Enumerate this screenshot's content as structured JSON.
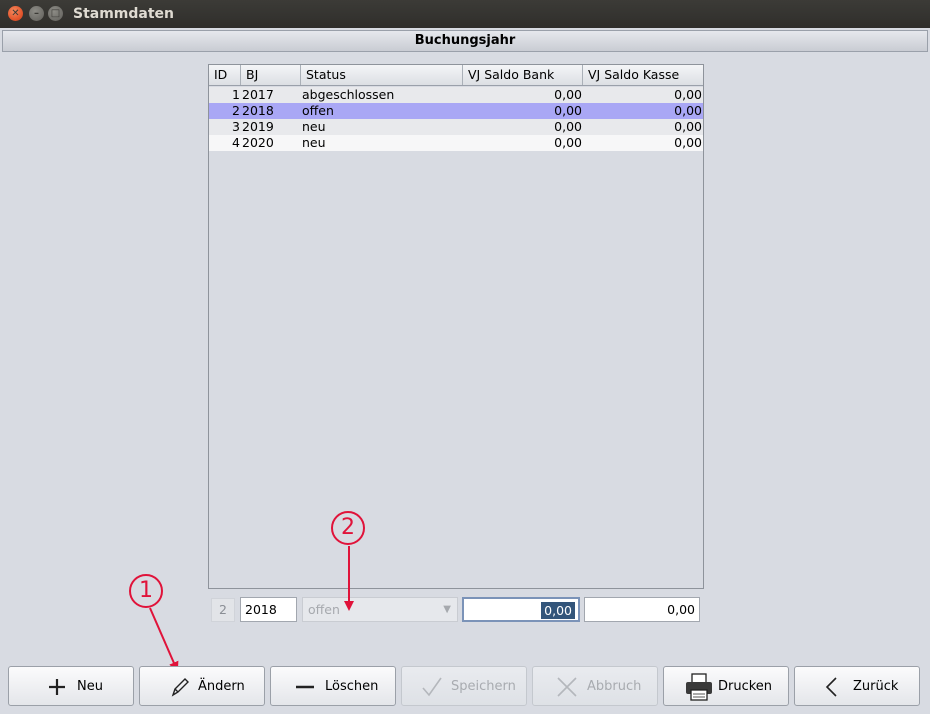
{
  "window": {
    "title": "Stammdaten"
  },
  "section": {
    "title": "Buchungsjahr"
  },
  "table": {
    "columns": [
      "ID",
      "BJ",
      "Status",
      "VJ Saldo Bank",
      "VJ Saldo Kasse"
    ],
    "rows": [
      {
        "id": "1",
        "bj": "2017",
        "status": "abgeschlossen",
        "bank": "0,00",
        "kasse": "0,00"
      },
      {
        "id": "2",
        "bj": "2018",
        "status": "offen",
        "bank": "0,00",
        "kasse": "0,00"
      },
      {
        "id": "3",
        "bj": "2019",
        "status": "neu",
        "bank": "0,00",
        "kasse": "0,00"
      },
      {
        "id": "4",
        "bj": "2020",
        "status": "neu",
        "bank": "0,00",
        "kasse": "0,00"
      }
    ],
    "selected_row": 2
  },
  "editor": {
    "id": "2",
    "bj": "2018",
    "status": "offen",
    "bank": "0,00",
    "kasse": "0,00"
  },
  "annotations": [
    "1",
    "2"
  ],
  "buttons": {
    "neu": "Neu",
    "aendern": "Ändern",
    "loeschen": "Löschen",
    "speichern": "Speichern",
    "abbruch": "Abbruch",
    "drucken": "Drucken",
    "zurueck": "Zurück"
  },
  "colors": {
    "selection": "#a9a7f5",
    "annotation": "#e0133a",
    "titlebar": "#3c3b37"
  }
}
